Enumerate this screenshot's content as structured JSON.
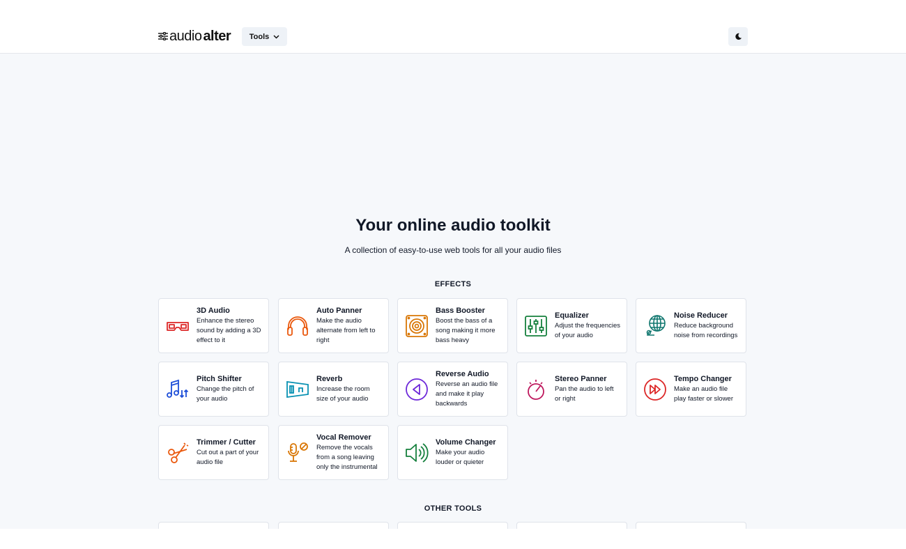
{
  "header": {
    "logo_part1": "audio",
    "logo_part2": "alter",
    "tools_label": "Tools"
  },
  "hero": {
    "title": "Your online audio toolkit",
    "subtitle": "A collection of easy-to-use web tools for all your audio files"
  },
  "sections": {
    "effects_title": "EFFECTS",
    "other_title": "OTHER TOOLS"
  },
  "effects": [
    {
      "title": "3D Audio",
      "desc": "Enhance the stereo sound by adding a 3D effect to it",
      "icon": "3d-glasses-icon",
      "color": "#dc2626"
    },
    {
      "title": "Auto Panner",
      "desc": "Make the audio alternate from left to right",
      "icon": "headphones-icon",
      "color": "#ea580c"
    },
    {
      "title": "Bass Booster",
      "desc": "Boost the bass of a song making it more bass heavy",
      "icon": "speaker-icon",
      "color": "#d97706"
    },
    {
      "title": "Equalizer",
      "desc": "Adjust the frequencies of your audio",
      "icon": "equalizer-icon",
      "color": "#15803d"
    },
    {
      "title": "Noise Reducer",
      "desc": "Reduce background noise from recordings",
      "icon": "globe-mic-icon",
      "color": "#0f766e"
    },
    {
      "title": "Pitch Shifter",
      "desc": "Change the pitch of your audio",
      "icon": "music-notes-icon",
      "color": "#1d4ed8"
    },
    {
      "title": "Reverb",
      "desc": "Increase the room size of your audio",
      "icon": "room-icon",
      "color": "#0891b2"
    },
    {
      "title": "Reverse Audio",
      "desc": "Reverse an audio file and make it play backwards",
      "icon": "reverse-play-icon",
      "color": "#6d28d9"
    },
    {
      "title": "Stereo Panner",
      "desc": "Pan the audio to left or right",
      "icon": "pan-knob-icon",
      "color": "#be185d"
    },
    {
      "title": "Tempo Changer",
      "desc": "Make an audio file play faster or slower",
      "icon": "fast-forward-icon",
      "color": "#dc2626"
    },
    {
      "title": "Trimmer / Cutter",
      "desc": "Cut out a part of your audio file",
      "icon": "scissors-icon",
      "color": "#ea580c"
    },
    {
      "title": "Vocal Remover",
      "desc": "Remove the vocals from a song leaving only the instrumental",
      "icon": "no-mic-icon",
      "color": "#d97706"
    },
    {
      "title": "Volume Changer",
      "desc": "Make your audio louder or quieter",
      "icon": "volume-icon",
      "color": "#15803d"
    }
  ]
}
